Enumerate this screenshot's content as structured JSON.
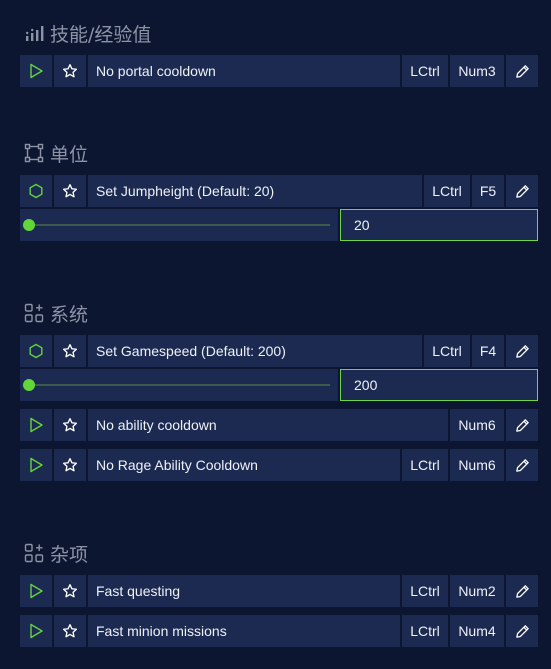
{
  "sections": [
    {
      "title": "技能/经验值",
      "icon": "bar-chart-icon",
      "items": [
        {
          "icon": "play-icon",
          "name": "No portal cooldown",
          "keys": [
            "LCtrl",
            "Num3"
          ]
        }
      ]
    },
    {
      "title": "单位",
      "icon": "unit-nodes-icon",
      "items": [
        {
          "icon": "hexagon-icon",
          "name": "Set Jumpheight (Default: 20)",
          "keys": [
            "LCtrl",
            "F5"
          ],
          "slider": {
            "value": "20",
            "fraction": 0.0
          }
        }
      ]
    },
    {
      "title": "系统",
      "icon": "grid-plus-icon",
      "items": [
        {
          "icon": "hexagon-icon",
          "name": "Set Gamespeed (Default: 200)",
          "keys": [
            "LCtrl",
            "F4"
          ],
          "slider": {
            "value": "200",
            "fraction": 0.0
          }
        },
        {
          "icon": "play-icon",
          "name": "No ability cooldown",
          "keys": [
            "Num6"
          ]
        },
        {
          "icon": "play-icon",
          "name": "No Rage Ability Cooldown",
          "keys": [
            "LCtrl",
            "Num6"
          ]
        }
      ]
    },
    {
      "title": "杂项",
      "icon": "grid-plus-icon",
      "items": [
        {
          "icon": "play-icon",
          "name": "Fast questing",
          "keys": [
            "LCtrl",
            "Num2"
          ]
        },
        {
          "icon": "play-icon",
          "name": "Fast minion missions",
          "keys": [
            "LCtrl",
            "Num4"
          ]
        }
      ]
    }
  ],
  "colors": {
    "background": "#0d1630",
    "cell": "#1c2a52",
    "accent_green": "#62d63a",
    "header_text": "#8c93a6"
  }
}
